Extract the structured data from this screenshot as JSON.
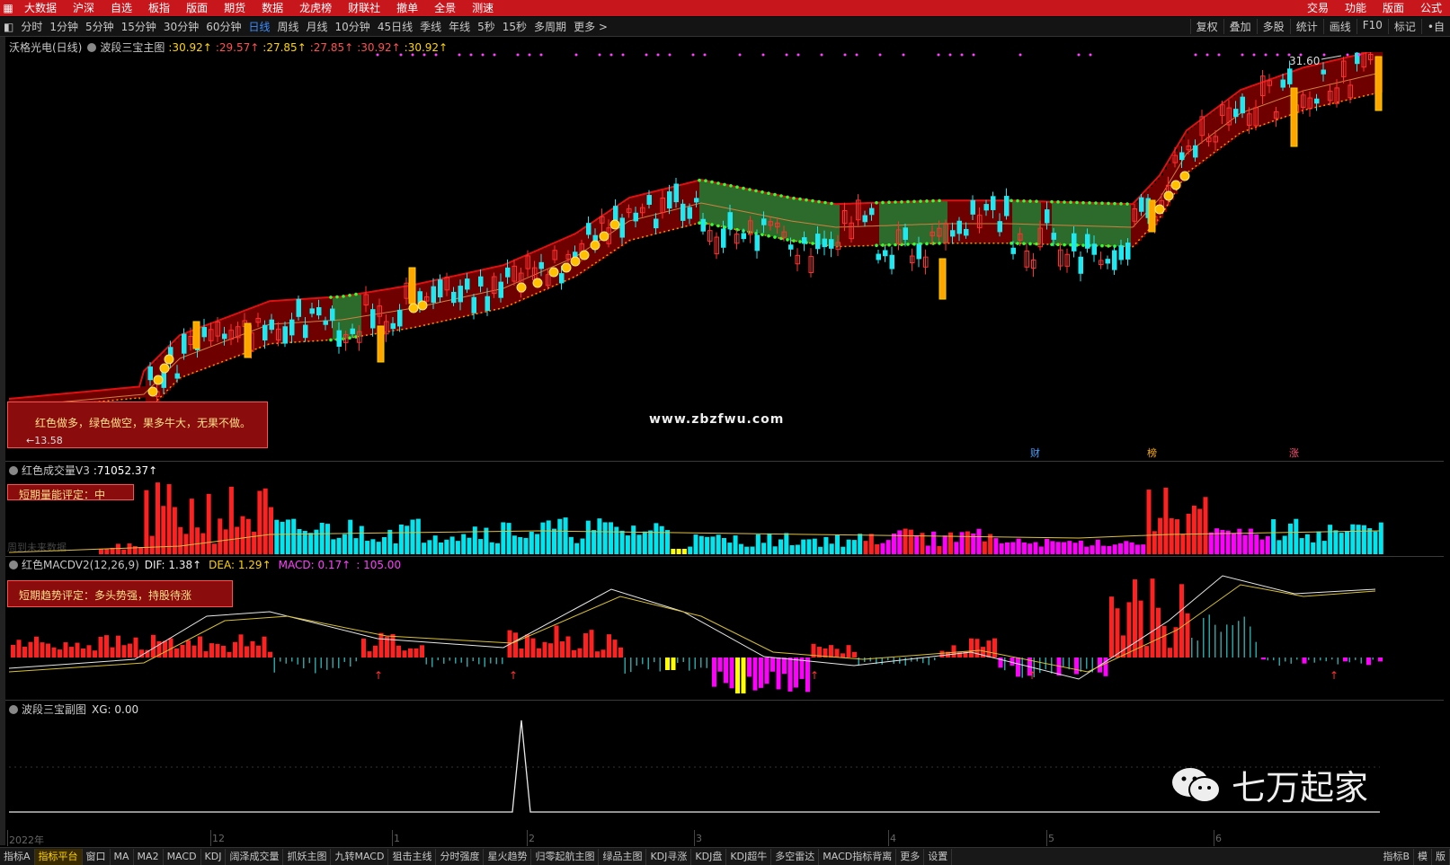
{
  "top_menu": {
    "left": [
      "大数据",
      "沪深",
      "自选",
      "板指",
      "版面",
      "期货",
      "数据",
      "龙虎榜",
      "财联社",
      "撤单",
      "全景",
      "测速"
    ],
    "right": [
      "交易",
      "功能",
      "版面",
      "公式"
    ]
  },
  "period_bar": {
    "items": [
      "分时",
      "1分钟",
      "5分钟",
      "15分钟",
      "30分钟",
      "60分钟",
      "日线",
      "周线",
      "月线",
      "10分钟",
      "45日线",
      "季线",
      "年线",
      "5秒",
      "15秒",
      "多周期",
      "更多 >"
    ],
    "active": "日线",
    "tools": [
      "复权",
      "叠加",
      "多股",
      "统计",
      "画线",
      "F10",
      "标记",
      "•自"
    ]
  },
  "main_chart": {
    "stock_label": "沃格光电(日线)",
    "indicator_name": "波段三宝主图",
    "values": [
      ":30.92↑",
      ":29.57↑",
      ":27.85↑",
      ":27.85↑",
      ":30.92↑",
      ":30.92↑"
    ],
    "value_colors": [
      "#ffd400",
      "#ff5050",
      "#ffd400",
      "#ff5050",
      "#ff5050",
      "#ffd400"
    ],
    "high_label": "31.60",
    "low_label": "←13.58",
    "note": "红色做多，绿色做空，果多牛大，无果不做。",
    "watermark": "www.zbzfwu.com",
    "event_marks": [
      "财",
      "榜",
      "涨"
    ]
  },
  "volume_panel": {
    "title": "红色成交量V3",
    "value": ":71052.37↑",
    "rating": "短期量能评定：中",
    "faint_text": "周到未来数据"
  },
  "macd_panel": {
    "title": "红色MACDV2(12,26,9)",
    "dif": "DIF: 1.38↑",
    "dea": "DEA: 1.29↑",
    "macd": "MACD: 0.17↑",
    "extra": ": 105.00",
    "trend": "短期趋势评定：多头势强，持股待涨"
  },
  "sub_panel": {
    "title": "波段三宝副图",
    "value": "XG: 0.00"
  },
  "date_axis": [
    "2022年",
    "12",
    "1",
    "2",
    "3",
    "4",
    "5",
    "6"
  ],
  "brand": "七万起家",
  "bottom_tabs": {
    "items": [
      "指标A",
      "指标平台",
      "窗口",
      "MA",
      "MA2",
      "MACD",
      "KDJ",
      "阔泽成交量",
      "抓妖主图",
      "九转MACD",
      "狙击主线",
      "分时强度",
      "星火趋势",
      "归零起航主图",
      "绿品主图",
      "KDJ寻涨",
      "KDJ盘",
      "KDJ超牛",
      "多空雷达",
      "MACD指标背离",
      "更多",
      "设置"
    ],
    "active": "指标平台",
    "right": [
      "指标B",
      "模",
      "版"
    ]
  },
  "colors": {
    "menu_red": "#c8161d",
    "up": "#ff2020",
    "down": "#00e5ee",
    "gold": "#ffa500",
    "magenta": "#ff00ff",
    "green_band": "#2c6b2c",
    "red_band": "#7a0000"
  }
}
